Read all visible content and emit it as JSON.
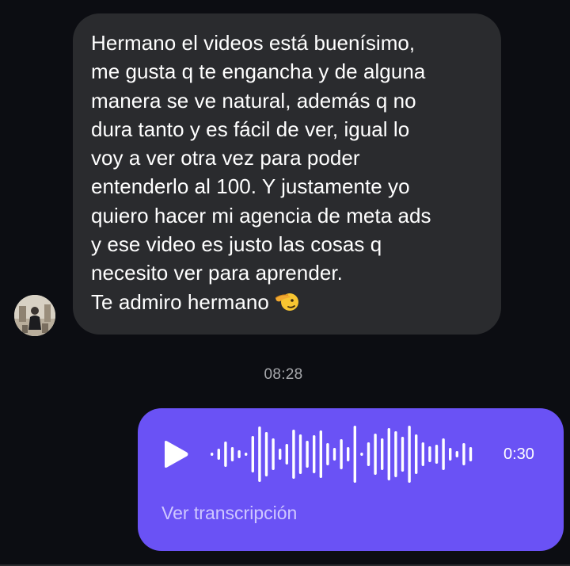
{
  "incoming_message": {
    "lines": [
      "Hermano el videos está buenísimo,",
      "me gusta q te engancha y de alguna",
      "manera se ve natural, además q no",
      "dura tanto y es fácil de ver, igual lo",
      "voy a ver otra vez para poder",
      "entenderlo al 100. Y justamente yo",
      "quiero hacer mi agencia de meta ads",
      "y ese video es justo las cosas q",
      "necesito ver para aprender.",
      "Te admiro hermano"
    ],
    "emoji": "saluting-face-emoji"
  },
  "timestamp": "08:28",
  "voice_message": {
    "duration": "0:30",
    "transcript_label": "Ver transcripción",
    "play_icon": "play-icon"
  },
  "colors": {
    "background": "#0c0d12",
    "incoming_bubble": "#2a2b2e",
    "outgoing_bubble": "#6a52f5",
    "timestamp": "#a8a9ad",
    "transcript_link": "#cfc8ff"
  }
}
